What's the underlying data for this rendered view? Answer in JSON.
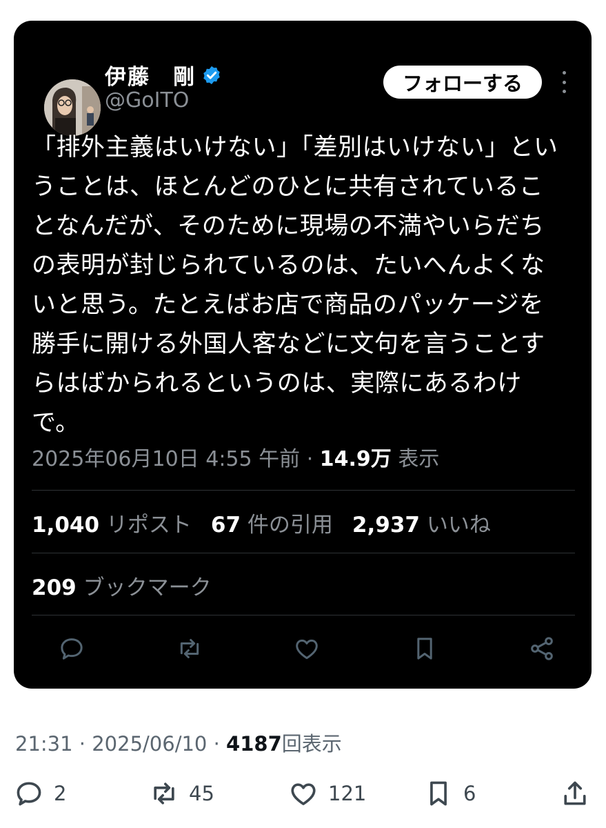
{
  "tweet": {
    "author_name": "伊藤　剛",
    "handle": "@GoITO",
    "follow_label": "フォローする",
    "text": "「排外主義はいけない」「差別はいけない」ということは、ほとんどのひとに共有されていることなんだが、そのために現場の不満やいらだちの表明が封じられているのは、たいへんよくないと思う。たとえばお店で商品のパッケージを勝手に開ける外国人客などに文句を言うことすらはばかられるというのは、実際にあるわけで。",
    "timestamp": "2025年06月10日 4:55 午前",
    "separator": "·",
    "views_count": "14.9万",
    "views_label": "表示",
    "retweets_count": "1,040",
    "retweets_label": "リポスト",
    "quotes_count": "67",
    "quotes_label": "件の引用",
    "likes_count": "2,937",
    "likes_label": "いいね",
    "bookmarks_count": "209",
    "bookmarks_label": "ブックマーク",
    "icons": [
      "reply-icon",
      "retweet-icon",
      "like-icon",
      "bookmark-icon",
      "share-icon"
    ]
  },
  "post": {
    "time": "21:31",
    "separator1": "·",
    "date": "2025/06/10",
    "separator2": "·",
    "views_count": "4187",
    "views_label": "回表示",
    "replies": "2",
    "reposts": "45",
    "likes": "121",
    "bookmarks": "6"
  },
  "colors": {
    "card_background": "#000000",
    "verified_badge": "#1d9bf0",
    "muted_text_dark": "#8b9096",
    "muted_text_light": "#5b6670",
    "divider": "#2f3336"
  }
}
